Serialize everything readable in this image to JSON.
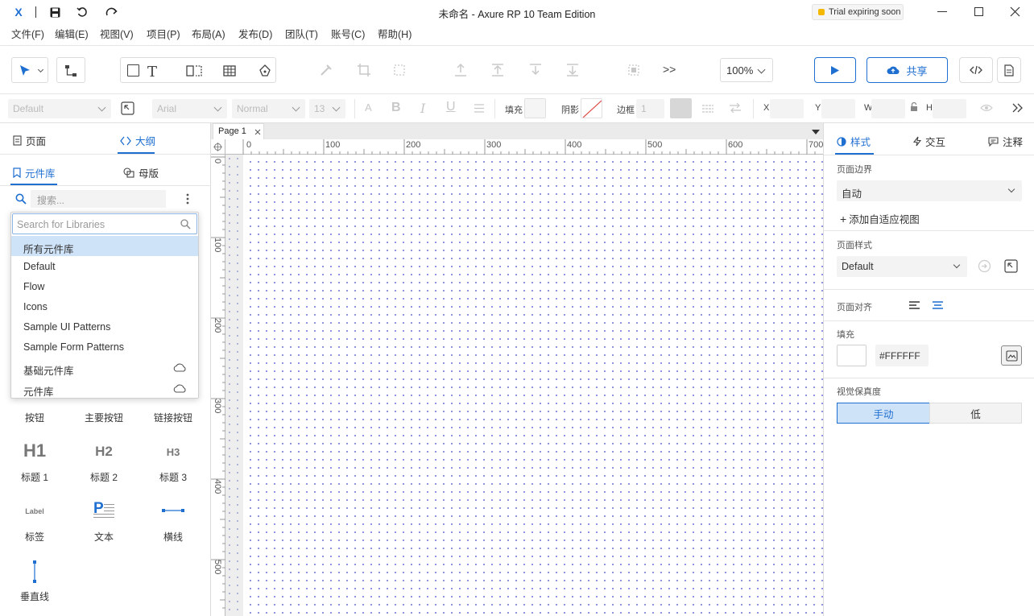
{
  "app": {
    "title": "未命名 - Axure RP 10 Team Edition",
    "trial_badge": "Trial expiring soon",
    "logo": "X"
  },
  "menu": [
    "文件(F)",
    "编辑(E)",
    "视图(V)",
    "项目(P)",
    "布局(A)",
    "发布(D)",
    "团队(T)",
    "账号(C)",
    "帮助(H)"
  ],
  "toolbar": {
    "zoom": "100%",
    "share_label": "共享",
    "more": ">>"
  },
  "format": {
    "style": "Default",
    "font": "Arial",
    "weight": "Normal",
    "size": "13",
    "fill_label": "填充",
    "shadow_label": "阴影",
    "border_label": "边框",
    "border_value": "1",
    "x_label": "X",
    "y_label": "Y",
    "w_label": "W",
    "h_label": "H"
  },
  "left": {
    "tab_pages": "页面",
    "tab_outline": "大纲",
    "tab_libraries": "元件库",
    "tab_masters": "母版",
    "search_placeholder": "搜索...",
    "lib_search_placeholder": "Search for Libraries",
    "libraries": [
      "所有元件库",
      "Default",
      "Flow",
      "Icons",
      "Sample UI Patterns",
      "Sample Form Patterns",
      "基础元件库",
      "元件库"
    ],
    "widgets": [
      {
        "label": "按钮"
      },
      {
        "label": "主要按钮"
      },
      {
        "label": "链接按钮"
      },
      {
        "label": "标题 1",
        "glyph": "H1"
      },
      {
        "label": "标题 2",
        "glyph": "H2"
      },
      {
        "label": "标题 3",
        "glyph": "H3"
      },
      {
        "label": "标签",
        "glyph": "Label"
      },
      {
        "label": "文本",
        "glyph": "P"
      },
      {
        "label": "横线"
      },
      {
        "label": "垂直线"
      }
    ]
  },
  "canvas": {
    "page_tab": "Page 1",
    "ruler_top": [
      "0",
      "100",
      "200",
      "300",
      "400",
      "500",
      "600",
      "700"
    ],
    "ruler_left": [
      "0",
      "100",
      "200",
      "300",
      "400",
      "500"
    ]
  },
  "right": {
    "tab_style": "样式",
    "tab_interact": "交互",
    "tab_notes": "注释",
    "page_bounds_label": "页面边界",
    "page_bounds_value": "自动",
    "add_adaptive": "添加自适应视图",
    "page_style_label": "页面样式",
    "page_style_value": "Default",
    "page_align_label": "页面对齐",
    "fill_label": "填充",
    "fill_value": "#FFFFFF",
    "fidelity_label": "视觉保真度",
    "fidelity_manual": "手动",
    "fidelity_low": "低"
  },
  "colors": {
    "accent": "#1f6fd1",
    "selected_bg": "#cfe3f8"
  }
}
